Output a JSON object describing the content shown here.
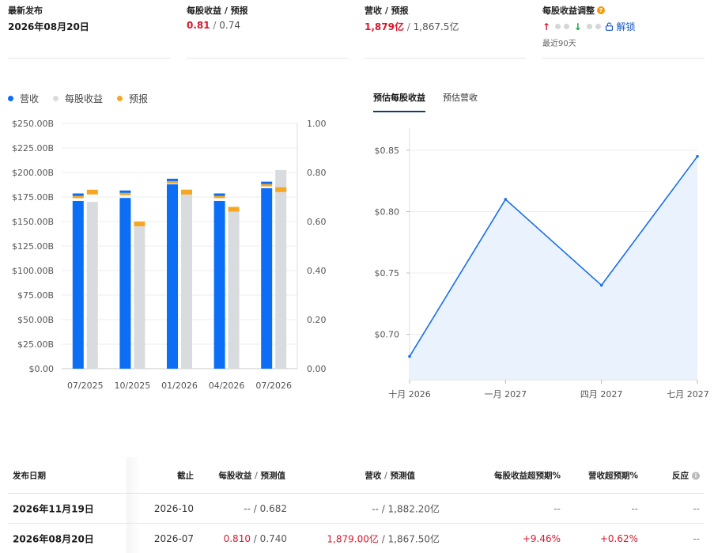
{
  "summary": {
    "release": {
      "title": "最新发布",
      "value": "2026年08月20日"
    },
    "eps": {
      "title": "每股收益 / 预报",
      "actual": "0.81",
      "sep": " / ",
      "estimate": "0.74"
    },
    "revenue": {
      "title": "营收 / 预报",
      "actual": "1,879亿",
      "sep": " / ",
      "estimate": "1,867.5亿"
    },
    "revision": {
      "title": "每股收益调整",
      "hint": "?",
      "up": "↑",
      "down": "↓",
      "unlock": "解锁",
      "period": "最近90天"
    }
  },
  "legend": [
    {
      "label": "营收",
      "color": "#0b6ef5"
    },
    {
      "label": "每股收益",
      "color": "#d9dcdf"
    },
    {
      "label": "预报",
      "color": "#f5a623"
    }
  ],
  "tabs": [
    {
      "label": "预估每股收益",
      "active": true
    },
    {
      "label": "预估营收",
      "active": false
    }
  ],
  "colors": {
    "revenue": "#0b6ef5",
    "eps": "#d9dcdf",
    "forecast": "#f5a623",
    "line": "#1a6fe8",
    "area": "#eaf2fd",
    "red": "#d8182c"
  },
  "chart_data": [
    {
      "type": "bar",
      "categories": [
        "07/2025",
        "10/2025",
        "01/2026",
        "04/2026",
        "07/2026"
      ],
      "left_ticks": [
        "$0.00",
        "$25.00B",
        "$50.00B",
        "$75.00B",
        "$100.00B",
        "$125.00B",
        "$150.00B",
        "$175.00B",
        "$200.00B",
        "$225.00B",
        "$250.00B"
      ],
      "right_ticks": [
        "0.00",
        "0.20",
        "0.40",
        "0.60",
        "0.80",
        "1.00"
      ],
      "ylim_left": [
        0,
        250
      ],
      "ylim_right": [
        0,
        1
      ],
      "series": [
        {
          "name": "营收",
          "axis": "left",
          "values": [
            171,
            174,
            188,
            171,
            184
          ]
        },
        {
          "name": "营收预报",
          "axis": "left",
          "values": [
            175,
            178,
            190,
            175,
            187
          ]
        },
        {
          "name": "每股收益",
          "axis": "right",
          "values": [
            0.68,
            0.58,
            0.73,
            0.64,
            0.81
          ]
        },
        {
          "name": "每股收益预报",
          "axis": "right",
          "values": [
            0.72,
            0.59,
            0.72,
            0.65,
            0.73
          ]
        }
      ],
      "grid": true
    },
    {
      "type": "area",
      "x": [
        "十月 2026",
        "一月 2027",
        "四月 2027",
        "七月 2027"
      ],
      "y": [
        0.682,
        0.81,
        0.74,
        0.845
      ],
      "y_ticks": [
        "$0.70",
        "$0.75",
        "$0.80",
        "$0.85"
      ],
      "ylim": [
        0.663,
        0.868
      ],
      "grid": true
    }
  ],
  "table": {
    "headers": {
      "date": "发布日期",
      "period": "截止",
      "eps": "每股收益",
      "eps_sep": " / ",
      "eps_est": "预测值",
      "rev": "营收",
      "rev_sep": " / ",
      "rev_est": "预测值",
      "eps_surprise": "每股收益超预期%",
      "rev_surprise": "营收超预期%",
      "reaction": "反应",
      "reaction_hint": "i"
    },
    "rows": [
      {
        "date": "2026年11月19日",
        "period": "2026-10",
        "eps": "--",
        "eps_sep": " / ",
        "eps_est": "0.682",
        "rev": "--",
        "rev_sep": " / ",
        "rev_est": "1,882.20亿",
        "eps_surprise": "--",
        "rev_surprise": "--",
        "reaction": "--"
      },
      {
        "date": "2026年08月20日",
        "period": "2026-07",
        "eps": "0.810",
        "eps_sep": " / ",
        "eps_est": "0.740",
        "rev": "1,879.00亿",
        "rev_sep": " / ",
        "rev_est": "1,867.50亿",
        "eps_surprise": "+9.46%",
        "rev_surprise": "+0.62%",
        "reaction": "--"
      }
    ]
  }
}
